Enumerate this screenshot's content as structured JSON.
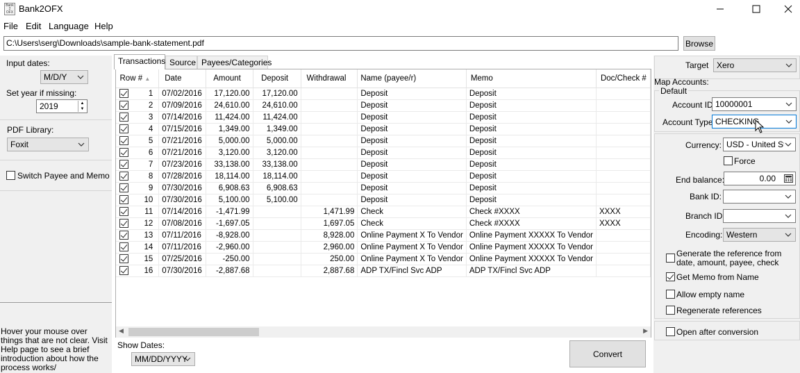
{
  "window": {
    "title": "Bank2OFX",
    "icon_text": "Bank 2 OFX"
  },
  "menu": [
    "File",
    "Edit",
    "Language",
    "Help"
  ],
  "file_path": "C:\\Users\\serg\\Downloads\\sample-bank-statement.pdf",
  "browse_label": "Browse",
  "left": {
    "input_dates_label": "Input dates:",
    "input_dates_value": "M/D/Y",
    "set_year_label": "Set year if missing:",
    "year_value": "2019",
    "pdf_library_label": "PDF Library:",
    "pdf_library_value": "Foxit",
    "switch_payee_label": "Switch Payee and Memo",
    "switch_payee_checked": false,
    "help_text": "Hover your mouse over things that are not clear. Visit Help page to see a brief introduction about how the process works/"
  },
  "tabs": [
    {
      "label": "Transactions",
      "active": true
    },
    {
      "label": "Source",
      "active": false
    },
    {
      "label": "Payees/Categories",
      "active": false
    }
  ],
  "grid": {
    "columns": [
      "Row #",
      "Date",
      "Amount",
      "Deposit",
      "Withdrawal",
      "Name (payee/r)",
      "Memo",
      "Doc/Check #"
    ],
    "rows": [
      {
        "checked": true,
        "row": "1",
        "date": "07/02/2016",
        "amount": "17,120.00",
        "deposit": "17,120.00",
        "withdrawal": "",
        "name": "Deposit",
        "memo": "Deposit",
        "doc": ""
      },
      {
        "checked": true,
        "row": "2",
        "date": "07/09/2016",
        "amount": "24,610.00",
        "deposit": "24,610.00",
        "withdrawal": "",
        "name": "Deposit",
        "memo": "Deposit",
        "doc": ""
      },
      {
        "checked": true,
        "row": "3",
        "date": "07/14/2016",
        "amount": "11,424.00",
        "deposit": "11,424.00",
        "withdrawal": "",
        "name": "Deposit",
        "memo": "Deposit",
        "doc": ""
      },
      {
        "checked": true,
        "row": "4",
        "date": "07/15/2016",
        "amount": "1,349.00",
        "deposit": "1,349.00",
        "withdrawal": "",
        "name": "Deposit",
        "memo": "Deposit",
        "doc": ""
      },
      {
        "checked": true,
        "row": "5",
        "date": "07/21/2016",
        "amount": "5,000.00",
        "deposit": "5,000.00",
        "withdrawal": "",
        "name": "Deposit",
        "memo": "Deposit",
        "doc": ""
      },
      {
        "checked": true,
        "row": "6",
        "date": "07/21/2016",
        "amount": "3,120.00",
        "deposit": "3,120.00",
        "withdrawal": "",
        "name": "Deposit",
        "memo": "Deposit",
        "doc": ""
      },
      {
        "checked": true,
        "row": "7",
        "date": "07/23/2016",
        "amount": "33,138.00",
        "deposit": "33,138.00",
        "withdrawal": "",
        "name": "Deposit",
        "memo": "Deposit",
        "doc": ""
      },
      {
        "checked": true,
        "row": "8",
        "date": "07/28/2016",
        "amount": "18,114.00",
        "deposit": "18,114.00",
        "withdrawal": "",
        "name": "Deposit",
        "memo": "Deposit",
        "doc": ""
      },
      {
        "checked": true,
        "row": "9",
        "date": "07/30/2016",
        "amount": "6,908.63",
        "deposit": "6,908.63",
        "withdrawal": "",
        "name": "Deposit",
        "memo": "Deposit",
        "doc": ""
      },
      {
        "checked": true,
        "row": "10",
        "date": "07/30/2016",
        "amount": "5,100.00",
        "deposit": "5,100.00",
        "withdrawal": "",
        "name": "Deposit",
        "memo": "Deposit",
        "doc": ""
      },
      {
        "checked": true,
        "row": "11",
        "date": "07/14/2016",
        "amount": "-1,471.99",
        "deposit": "",
        "withdrawal": "1,471.99",
        "name": "Check",
        "memo": "Check #XXXX",
        "doc": "XXXX"
      },
      {
        "checked": true,
        "row": "12",
        "date": "07/08/2016",
        "amount": "-1,697.05",
        "deposit": "",
        "withdrawal": "1,697.05",
        "name": "Check",
        "memo": "Check #XXXX",
        "doc": "XXXX"
      },
      {
        "checked": true,
        "row": "13",
        "date": "07/11/2016",
        "amount": "-8,928.00",
        "deposit": "",
        "withdrawal": "8,928.00",
        "name": "Online Payment X To Vendor",
        "memo": "Online Payment XXXXX To Vendor",
        "doc": ""
      },
      {
        "checked": true,
        "row": "14",
        "date": "07/11/2016",
        "amount": "-2,960.00",
        "deposit": "",
        "withdrawal": "2,960.00",
        "name": "Online Payment X To Vendor",
        "memo": "Online Payment XXXXX To Vendor",
        "doc": ""
      },
      {
        "checked": true,
        "row": "15",
        "date": "07/25/2016",
        "amount": "-250.00",
        "deposit": "",
        "withdrawal": "250.00",
        "name": "Online Payment X To Vendor",
        "memo": "Online Payment XXXXX To Vendor",
        "doc": ""
      },
      {
        "checked": true,
        "row": "16",
        "date": "07/30/2016",
        "amount": "-2,887.68",
        "deposit": "",
        "withdrawal": "2,887.68",
        "name": "ADP TX/Fincl Svc ADP",
        "memo": "ADP TX/Fincl Svc ADP",
        "doc": ""
      }
    ]
  },
  "show_dates_label": "Show Dates:",
  "show_dates_value": "MM/DD/YYYY",
  "convert_label": "Convert",
  "right": {
    "target_label": "Target",
    "target_value": "Xero",
    "map_accounts_label": "Map Accounts:",
    "default_label": "Default",
    "account_id_label": "Account ID:",
    "account_id_value": "10000001",
    "account_type_label": "Account Type:",
    "account_type_value": "CHECKING",
    "currency_label": "Currency:",
    "currency_value": "USD - United Sta",
    "force_label": "Force",
    "end_balance_label": "End balance:",
    "end_balance_value": "0.00",
    "bank_id_label": "Bank ID:",
    "branch_id_label": "Branch ID",
    "encoding_label": "Encoding:",
    "encoding_value": "Western",
    "gen_ref_label": "Generate the reference from date, amount, payee, check",
    "get_memo_label": "Get Memo from Name",
    "allow_empty_label": "Allow empty name",
    "regen_refs_label": "Regenerate references",
    "open_after_label": "Open after conversion"
  }
}
